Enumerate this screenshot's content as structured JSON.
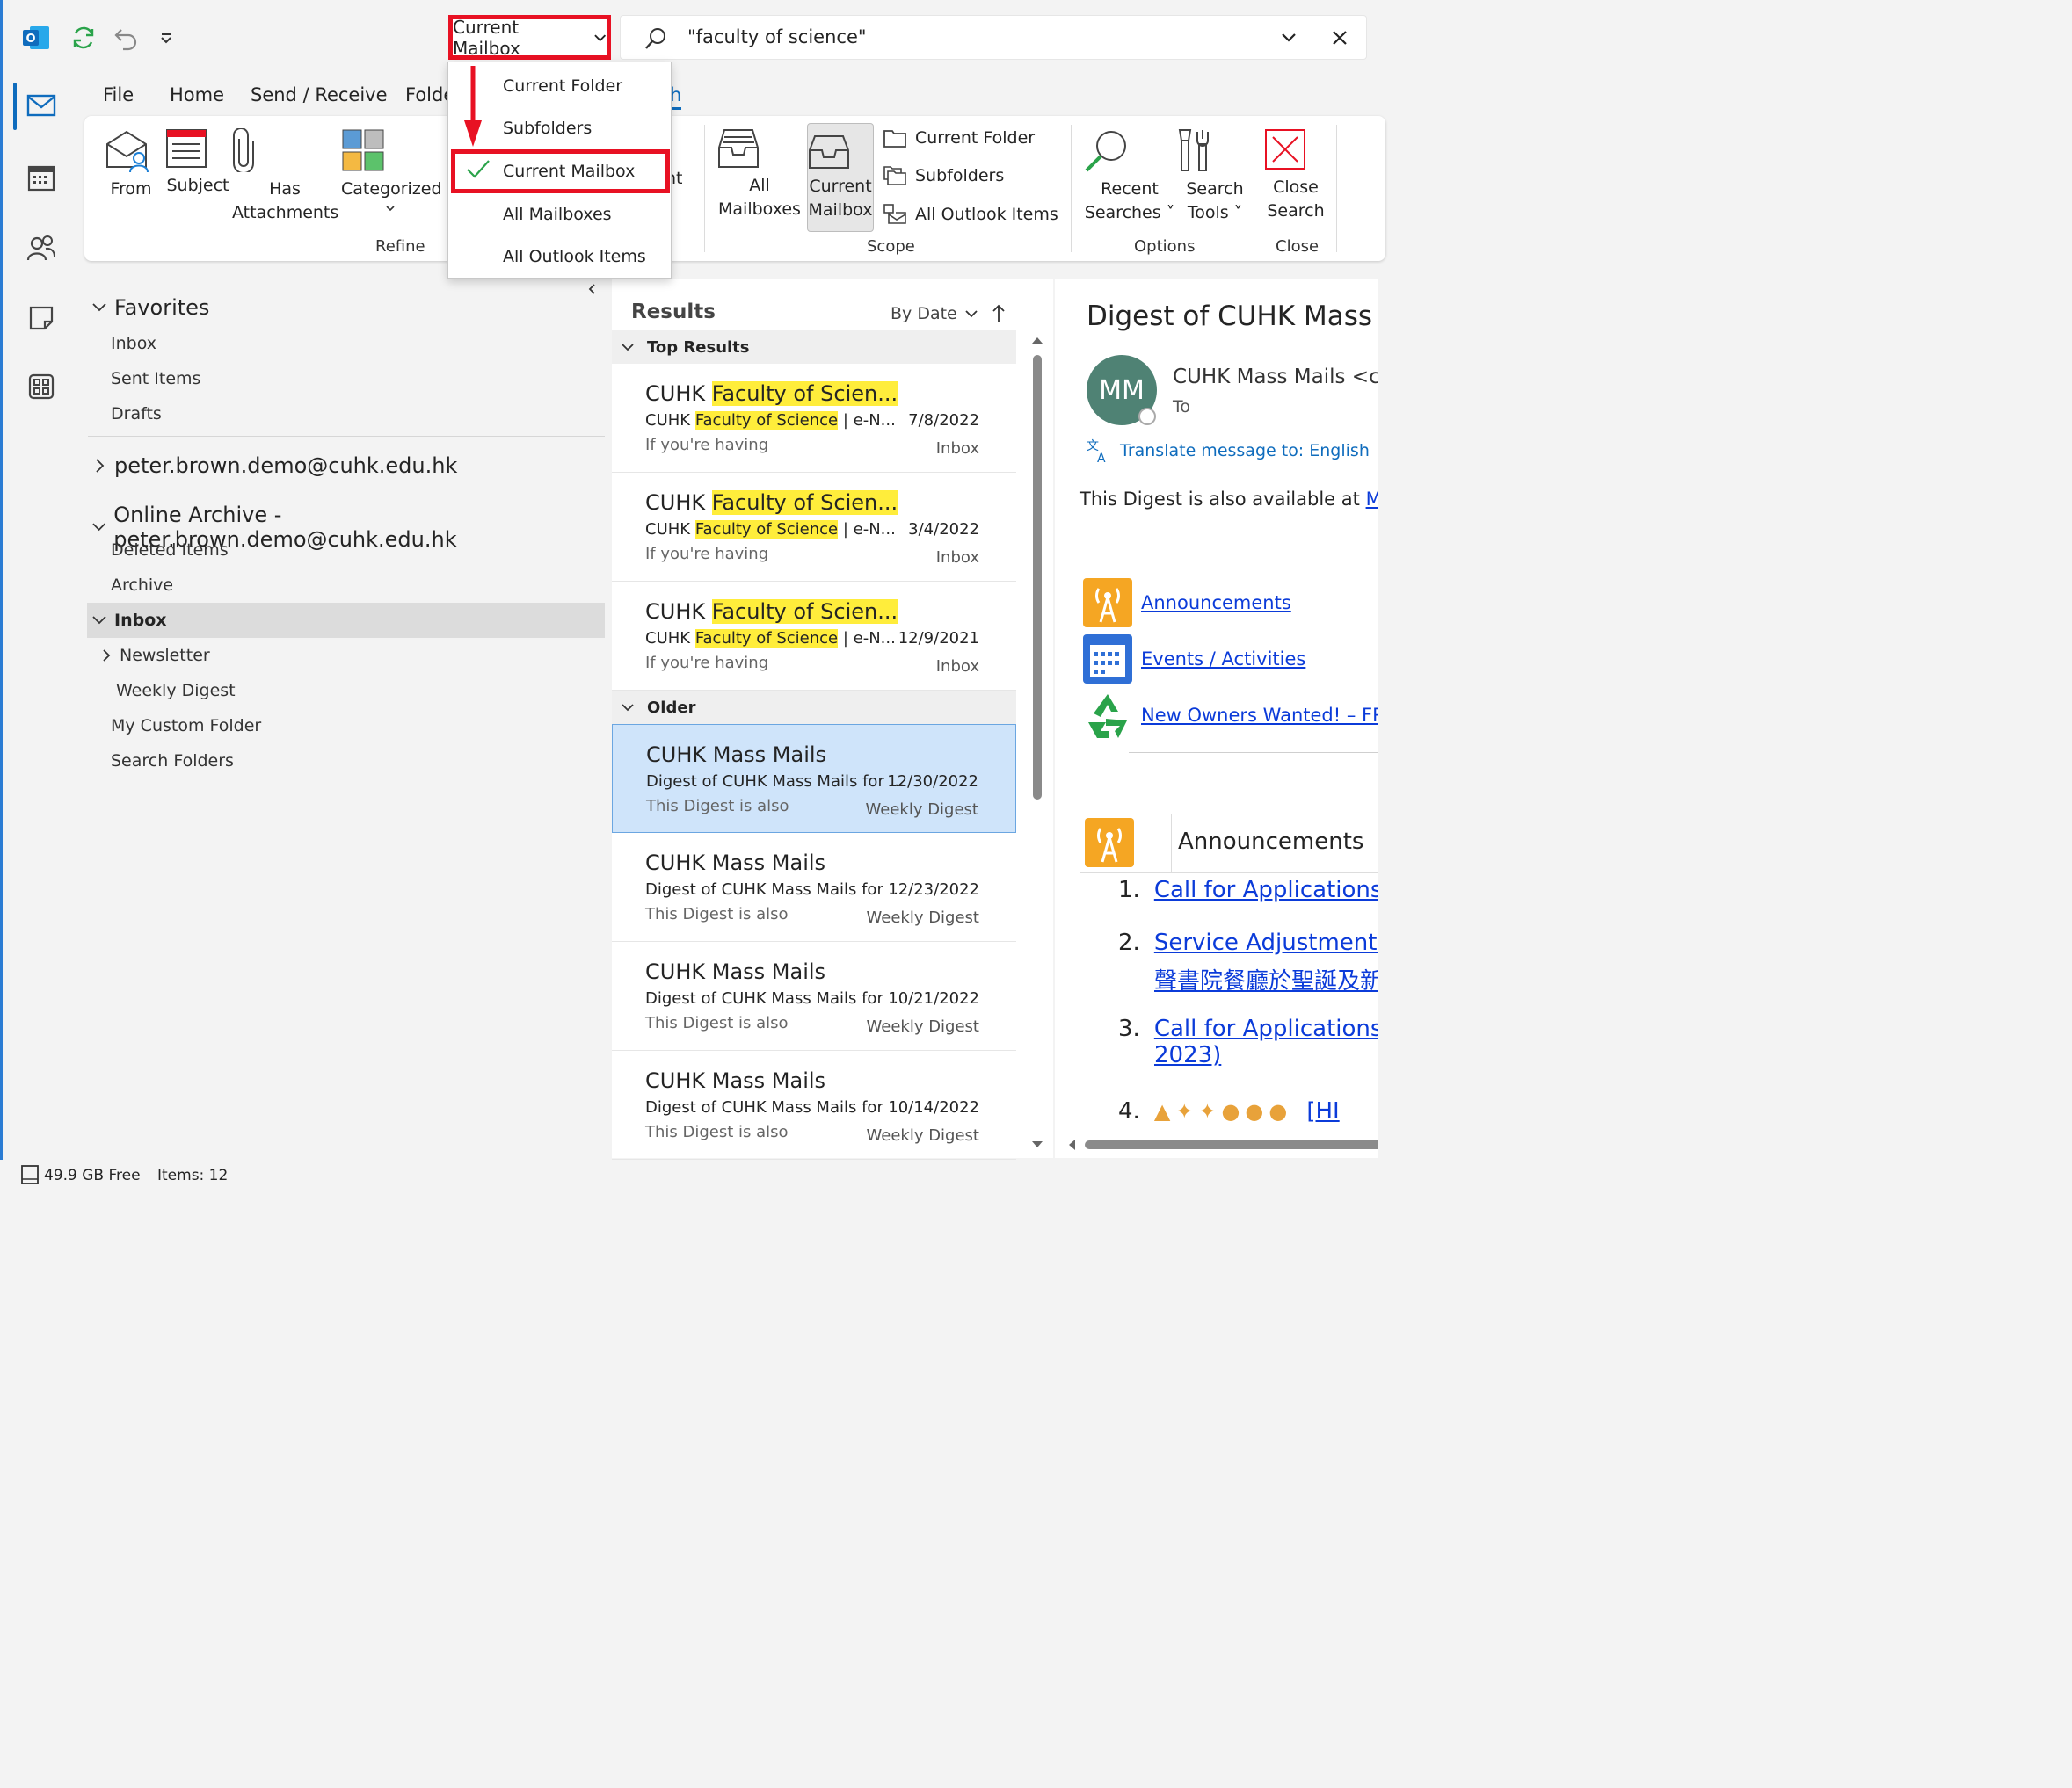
{
  "titlebar": {
    "scope_button": "Current Mailbox",
    "search_query": "\"faculty of science\""
  },
  "tabs": [
    "File",
    "Home",
    "Send / Receive",
    "Folde",
    "h"
  ],
  "ribbon": {
    "refine": {
      "from": "From",
      "subject": "Subject",
      "has_attachments_1": "Has",
      "has_attachments_2": "Attachments",
      "categorized": "Categorized",
      "label": "Refine",
      "partial": "nt"
    },
    "scope": {
      "all_mailboxes_1": "All",
      "all_mailboxes_2": "Mailboxes",
      "current_mailbox_1": "Current",
      "current_mailbox_2": "Mailbox",
      "current_folder": "Current Folder",
      "subfolders": "Subfolders",
      "all_outlook_items": "All Outlook Items",
      "label": "Scope"
    },
    "options": {
      "recent_1": "Recent",
      "recent_2": "Searches",
      "tools_1": "Search",
      "tools_2": "Tools",
      "label": "Options"
    },
    "close": {
      "close_1": "Close",
      "close_2": "Search",
      "label": "Close"
    }
  },
  "dropdown": {
    "items": [
      "Current Folder",
      "Subfolders",
      "Current Mailbox",
      "All Mailboxes",
      "All Outlook Items"
    ]
  },
  "folders": {
    "favorites": "Favorites",
    "fav_items": [
      "Inbox",
      "Sent Items",
      "Drafts"
    ],
    "account": "peter.brown.demo@cuhk.edu.hk",
    "archive": "Online Archive - peter.brown.demo@cuhk.edu.hk",
    "archive_items": [
      "Deleted Items",
      "Archive"
    ],
    "inbox": "Inbox",
    "inbox_children": [
      "Newsletter",
      "Weekly Digest"
    ],
    "others": [
      "My Custom Folder",
      "Search Folders"
    ]
  },
  "list": {
    "title": "Results",
    "sort": "By Date",
    "group_top": "Top Results",
    "group_older": "Older",
    "top": [
      {
        "from_a": "CUHK ",
        "from_hl": "Faculty of Scien...",
        "subj_a": "CUHK ",
        "subj_hl": "Faculty of Science",
        "subj_b": " |  e-N...",
        "date": "7/8/2022",
        "preview": "If you're having",
        "folder": "Inbox"
      },
      {
        "from_a": "CUHK ",
        "from_hl": "Faculty of Scien...",
        "subj_a": "CUHK ",
        "subj_hl": "Faculty of Science",
        "subj_b": " |  e-N...",
        "date": "3/4/2022",
        "preview": "If you're having",
        "folder": "Inbox"
      },
      {
        "from_a": "CUHK ",
        "from_hl": "Faculty of Scien...",
        "subj_a": "CUHK ",
        "subj_hl": "Faculty of Science",
        "subj_b": " |  e-N...",
        "date": "12/9/2021",
        "preview": "If you're having",
        "folder": "Inbox"
      }
    ],
    "older": [
      {
        "from": "CUHK Mass Mails",
        "subject": "Digest of CUHK Mass Mails for ...",
        "date": "12/30/2022",
        "preview": "This Digest is also",
        "folder": "Weekly Digest"
      },
      {
        "from": "CUHK Mass Mails",
        "subject": "Digest of CUHK Mass Mails for ...",
        "date": "12/23/2022",
        "preview": "This Digest is also",
        "folder": "Weekly Digest"
      },
      {
        "from": "CUHK Mass Mails",
        "subject": "Digest of CUHK Mass Mails for ...",
        "date": "10/21/2022",
        "preview": "This Digest is also",
        "folder": "Weekly Digest"
      },
      {
        "from": "CUHK Mass Mails",
        "subject": "Digest of CUHK Mass Mails for ...",
        "date": "10/14/2022",
        "preview": "This Digest is also",
        "folder": "Weekly Digest"
      }
    ]
  },
  "reader": {
    "subject": "Digest of CUHK Mass M",
    "avatar": "MM",
    "sender": "CUHK Mass Mails <cu",
    "to": "To",
    "translate": "Translate message to: English",
    "body_intro": "This Digest is also available at ",
    "body_link": "MyC",
    "toc": [
      "Announcements",
      "Events / Activities",
      "New Owners Wanted! – FRE"
    ],
    "section": "Announcements",
    "items": [
      {
        "num": "1.",
        "text": "Call for Applications: N"
      },
      {
        "num": "2.",
        "text": "Service Adjustments o",
        "text2": "聲書院餐廳於聖誕及新"
      },
      {
        "num": "3.",
        "text": "Call for Applications: O",
        "text2": "2023)"
      },
      {
        "num": "4.",
        "text": "[HI"
      }
    ]
  },
  "status": {
    "free": "49.9 GB Free",
    "items": "Items: 12"
  },
  "colors": {
    "accent": "#0f6cbd",
    "highlight_red": "#e81123",
    "search_highlight": "#ffed3b",
    "selected_message": "#cfe4fa",
    "link": "#0b3bd9",
    "avatar": "#4f8274"
  }
}
